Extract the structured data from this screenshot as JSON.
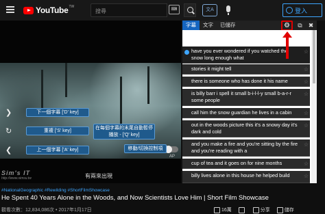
{
  "header": {
    "logo_text": "YouTube",
    "logo_region": "TW",
    "search_placeholder": "搜尋",
    "keyboard_icon_text": "⌨",
    "translate_icon_text": "文A",
    "login_label": "登入"
  },
  "video": {
    "overlay_buttons": {
      "next_caption": "下一個字幕 ['D' key]",
      "repeat": "重複 ['S' key]",
      "auto_pause": "在每個字幕的末尾自動暫停播放 - ['Q' key]",
      "prev_caption": "上一個字幕 ['A' key]",
      "move_toggle": "移動/切換控制項"
    },
    "toggle_label": "AP",
    "burned_subtitle": "有兩來出現"
  },
  "watermark": {
    "line1": "Sim's IT",
    "line2": "http://www.simsu.tw"
  },
  "info": {
    "tags": "#NationalGeographic #Rewilding #ShortFilmShowcase",
    "title": "He Spent 40 Years Alone in the Woods, and Now Scientists Love Him | Short Film Showcase",
    "meta": "觀看次數：12,834,086次 • 2017年1月17日",
    "likes": "16萬",
    "dislike_icon": "dislike-icon",
    "share_label": "分享",
    "save_label": "儲存"
  },
  "panel": {
    "tabs": [
      "字幕",
      "文字",
      "已儲存"
    ],
    "active_tab": 0,
    "tool_gear": "⚙",
    "tool_open": "⧉",
    "tool_close": "✖",
    "lines": [
      "have you ever wondered if you watched the snow long enough what",
      "stories it might tell",
      "there is someone who has done it his name",
      "is billy barr i spell it small b-i-l-l-y small b-a-r-r some people",
      "call him the snow guardian he lives in a cabin",
      "out in the woods picture this it's a snowy day it's dark and cold",
      "and you make a fire and you're sitting by the fire and you're reading with a",
      "cup of tea and it goes on for nine months",
      "billy lives alone in this house he helped build"
    ],
    "current_index": 0
  },
  "colors": {
    "accent_blue": "#3ea6ff",
    "highlight_red": "#e00000",
    "tab_active": "#1565c0",
    "brand_red": "#ff0000"
  }
}
